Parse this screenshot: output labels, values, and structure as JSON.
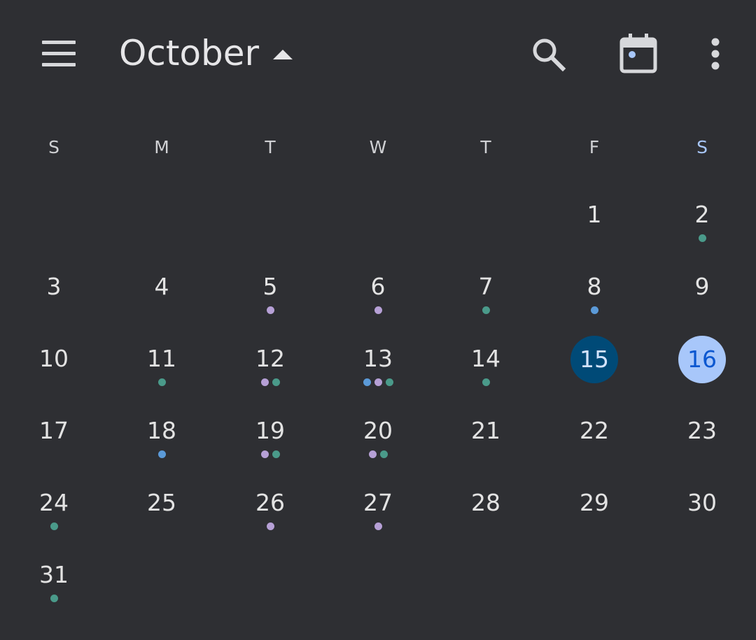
{
  "header": {
    "title": "October",
    "menu_icon": "hamburger-menu-icon",
    "title_caret_icon": "arrow-up-caret-icon",
    "search_icon": "search-icon",
    "today_icon": "calendar-today-icon",
    "more_icon": "more-vertical-icon"
  },
  "colors": {
    "background": "#2e2f33",
    "teal_event": "#4a9a8a",
    "purple_event": "#b6a0d6",
    "blue_event": "#5b9ad8",
    "today_dark": "#004a77",
    "selected_light": "#a8c7fa",
    "saturday_label": "#a8c7fa"
  },
  "weekdays": [
    "S",
    "M",
    "T",
    "W",
    "T",
    "F",
    "S"
  ],
  "days": [
    {
      "day": "1",
      "col": 5,
      "row": 0,
      "dots": []
    },
    {
      "day": "2",
      "col": 6,
      "row": 0,
      "dots": [
        "teal"
      ]
    },
    {
      "day": "3",
      "col": 0,
      "row": 1,
      "dots": []
    },
    {
      "day": "4",
      "col": 1,
      "row": 1,
      "dots": []
    },
    {
      "day": "5",
      "col": 2,
      "row": 1,
      "dots": [
        "purple"
      ]
    },
    {
      "day": "6",
      "col": 3,
      "row": 1,
      "dots": [
        "purple"
      ]
    },
    {
      "day": "7",
      "col": 4,
      "row": 1,
      "dots": [
        "teal"
      ]
    },
    {
      "day": "8",
      "col": 5,
      "row": 1,
      "dots": [
        "blue"
      ]
    },
    {
      "day": "9",
      "col": 6,
      "row": 1,
      "dots": []
    },
    {
      "day": "10",
      "col": 0,
      "row": 2,
      "dots": []
    },
    {
      "day": "11",
      "col": 1,
      "row": 2,
      "dots": [
        "teal"
      ]
    },
    {
      "day": "12",
      "col": 2,
      "row": 2,
      "dots": [
        "purple",
        "teal"
      ]
    },
    {
      "day": "13",
      "col": 3,
      "row": 2,
      "dots": [
        "blue",
        "purple",
        "teal"
      ]
    },
    {
      "day": "14",
      "col": 4,
      "row": 2,
      "dots": [
        "teal"
      ]
    },
    {
      "day": "15",
      "col": 5,
      "row": 2,
      "dots": [],
      "highlight": "dark"
    },
    {
      "day": "16",
      "col": 6,
      "row": 2,
      "dots": [],
      "highlight": "light"
    },
    {
      "day": "17",
      "col": 0,
      "row": 3,
      "dots": []
    },
    {
      "day": "18",
      "col": 1,
      "row": 3,
      "dots": [
        "blue"
      ]
    },
    {
      "day": "19",
      "col": 2,
      "row": 3,
      "dots": [
        "purple",
        "teal"
      ]
    },
    {
      "day": "20",
      "col": 3,
      "row": 3,
      "dots": [
        "purple",
        "teal"
      ]
    },
    {
      "day": "21",
      "col": 4,
      "row": 3,
      "dots": []
    },
    {
      "day": "22",
      "col": 5,
      "row": 3,
      "dots": []
    },
    {
      "day": "23",
      "col": 6,
      "row": 3,
      "dots": []
    },
    {
      "day": "24",
      "col": 0,
      "row": 4,
      "dots": [
        "teal"
      ]
    },
    {
      "day": "25",
      "col": 1,
      "row": 4,
      "dots": []
    },
    {
      "day": "26",
      "col": 2,
      "row": 4,
      "dots": [
        "purple"
      ]
    },
    {
      "day": "27",
      "col": 3,
      "row": 4,
      "dots": [
        "purple"
      ]
    },
    {
      "day": "28",
      "col": 4,
      "row": 4,
      "dots": []
    },
    {
      "day": "29",
      "col": 5,
      "row": 4,
      "dots": []
    },
    {
      "day": "30",
      "col": 6,
      "row": 4,
      "dots": []
    },
    {
      "day": "31",
      "col": 0,
      "row": 5,
      "dots": [
        "teal"
      ]
    }
  ]
}
